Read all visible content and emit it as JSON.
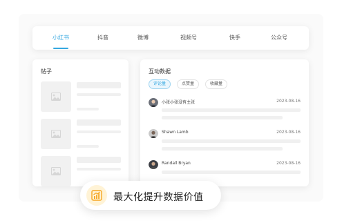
{
  "tabs": [
    {
      "label": "小红书",
      "active": true
    },
    {
      "label": "抖音",
      "active": false
    },
    {
      "label": "微博",
      "active": false
    },
    {
      "label": "视频号",
      "active": false
    },
    {
      "label": "快手",
      "active": false
    },
    {
      "label": "公众号",
      "active": false
    }
  ],
  "posts_panel": {
    "title": "帖子"
  },
  "interaction_panel": {
    "title": "互动数据",
    "filters": [
      {
        "label": "评论量",
        "active": true
      },
      {
        "label": "点赞量",
        "active": false
      },
      {
        "label": "收藏量",
        "active": false
      }
    ],
    "comments": [
      {
        "name": "小张小张没有主张",
        "date": "2023-08-16"
      },
      {
        "name": "Shawn Lamb",
        "date": "2023-08-16"
      },
      {
        "name": "Randall Bryan",
        "date": "2023-08-16"
      }
    ]
  },
  "banner": {
    "text": "最大化提升数据价值",
    "icon": "bar-chart-icon"
  },
  "colors": {
    "accent": "#34a7e0",
    "banner_icon_bg": "#fff3d6",
    "banner_icon_fg": "#f5a623"
  }
}
